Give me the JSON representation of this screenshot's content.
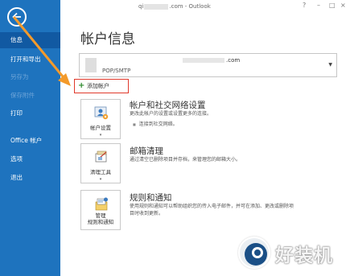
{
  "window": {
    "title_prefix": "qi",
    "title_suffix": ".com - Outlook",
    "help": "?",
    "minimize": "–",
    "restore": "□",
    "close": "×"
  },
  "sidebar": {
    "items": [
      {
        "label": "信息"
      },
      {
        "label": "打开和导出"
      },
      {
        "label": "另存为"
      },
      {
        "label": "保存附件"
      },
      {
        "label": "打印"
      },
      {
        "label": "Office 帐户"
      },
      {
        "label": "选项"
      },
      {
        "label": "退出"
      }
    ]
  },
  "main": {
    "page_title": "帐户信息",
    "account": {
      "email_suffix": ".com",
      "type": "POP/SMTP"
    },
    "add_account_label": "添加帐户",
    "sections": [
      {
        "tile_label": "帐户设置",
        "heading": "帐户和社交网络设置",
        "desc": [
          "更改此帐户的设置或设置更多的连接。"
        ],
        "bullet": "连接到社交网络。"
      },
      {
        "tile_label": "清理工具",
        "heading": "邮箱清理",
        "desc": [
          "通过清空已删除项目并存档，来管理您的邮箱大小。"
        ]
      },
      {
        "tile_label_line1": "管理",
        "tile_label_line2": "规则和通知",
        "heading": "规则和通知",
        "desc": [
          "使用规则和通知可以帮助组织您的传入电子邮件，并可在添加、更改或删除项",
          "目时收到更新。"
        ]
      }
    ]
  },
  "watermark": {
    "text": "好装机"
  },
  "colors": {
    "sidebar": "#1e73be",
    "sidebar_active": "#1159a2",
    "highlight_box": "#e0392b",
    "annotation_arrow": "#f39a2b"
  }
}
